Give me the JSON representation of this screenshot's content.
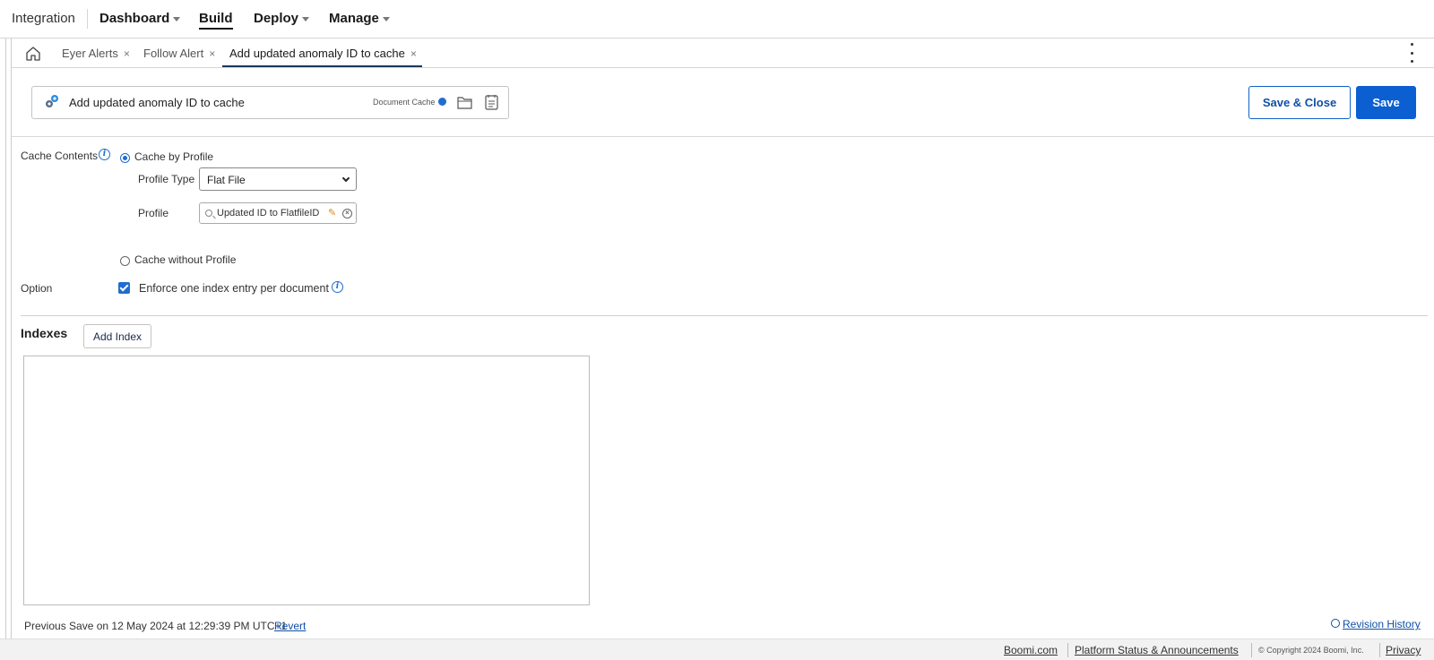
{
  "nav": {
    "brand": "Integration",
    "items": [
      {
        "label": "Dashboard",
        "has_caret": true
      },
      {
        "label": "Build",
        "active": true
      },
      {
        "label": "Deploy",
        "has_caret": true
      },
      {
        "label": "Manage",
        "has_caret": true
      }
    ]
  },
  "tabs": [
    {
      "label": "Eyer Alerts"
    },
    {
      "label": "Follow Alert"
    },
    {
      "label": "Add updated anomaly ID to cache",
      "active": true
    }
  ],
  "tab_close_glyph": "×",
  "component": {
    "name": "Add updated anomaly ID to cache",
    "type": "Document Cache"
  },
  "buttons": {
    "save_close": "Save & Close",
    "save": "Save",
    "add_index": "Add Index"
  },
  "form": {
    "cache_contents_label": "Cache Contents",
    "cache_by_profile": "Cache by Profile",
    "cache_by_profile_selected": true,
    "profile_type_label": "Profile Type",
    "profile_type_value": "Flat File",
    "profile_label": "Profile",
    "profile_value": "Updated ID to FlatfileID",
    "cache_without_profile": "Cache without Profile",
    "option_label": "Option",
    "enforce_label": "Enforce one index entry per document",
    "enforce_checked": true
  },
  "indexes": {
    "title": "Indexes"
  },
  "status": {
    "previous_save": "Previous Save on 12 May 2024 at 12:29:39 PM UTC+1",
    "revert": "Revert",
    "revision_history": "Revision History"
  },
  "footer": {
    "boomi": "Boomi.com",
    "platform_status": "Platform Status & Announcements",
    "copyright": "© Copyright 2024 Boomi, Inc.",
    "privacy": "Privacy"
  },
  "colors": {
    "accent": "#0b5fd1",
    "link": "#0f4fa8",
    "info": "#1f6dcf"
  }
}
